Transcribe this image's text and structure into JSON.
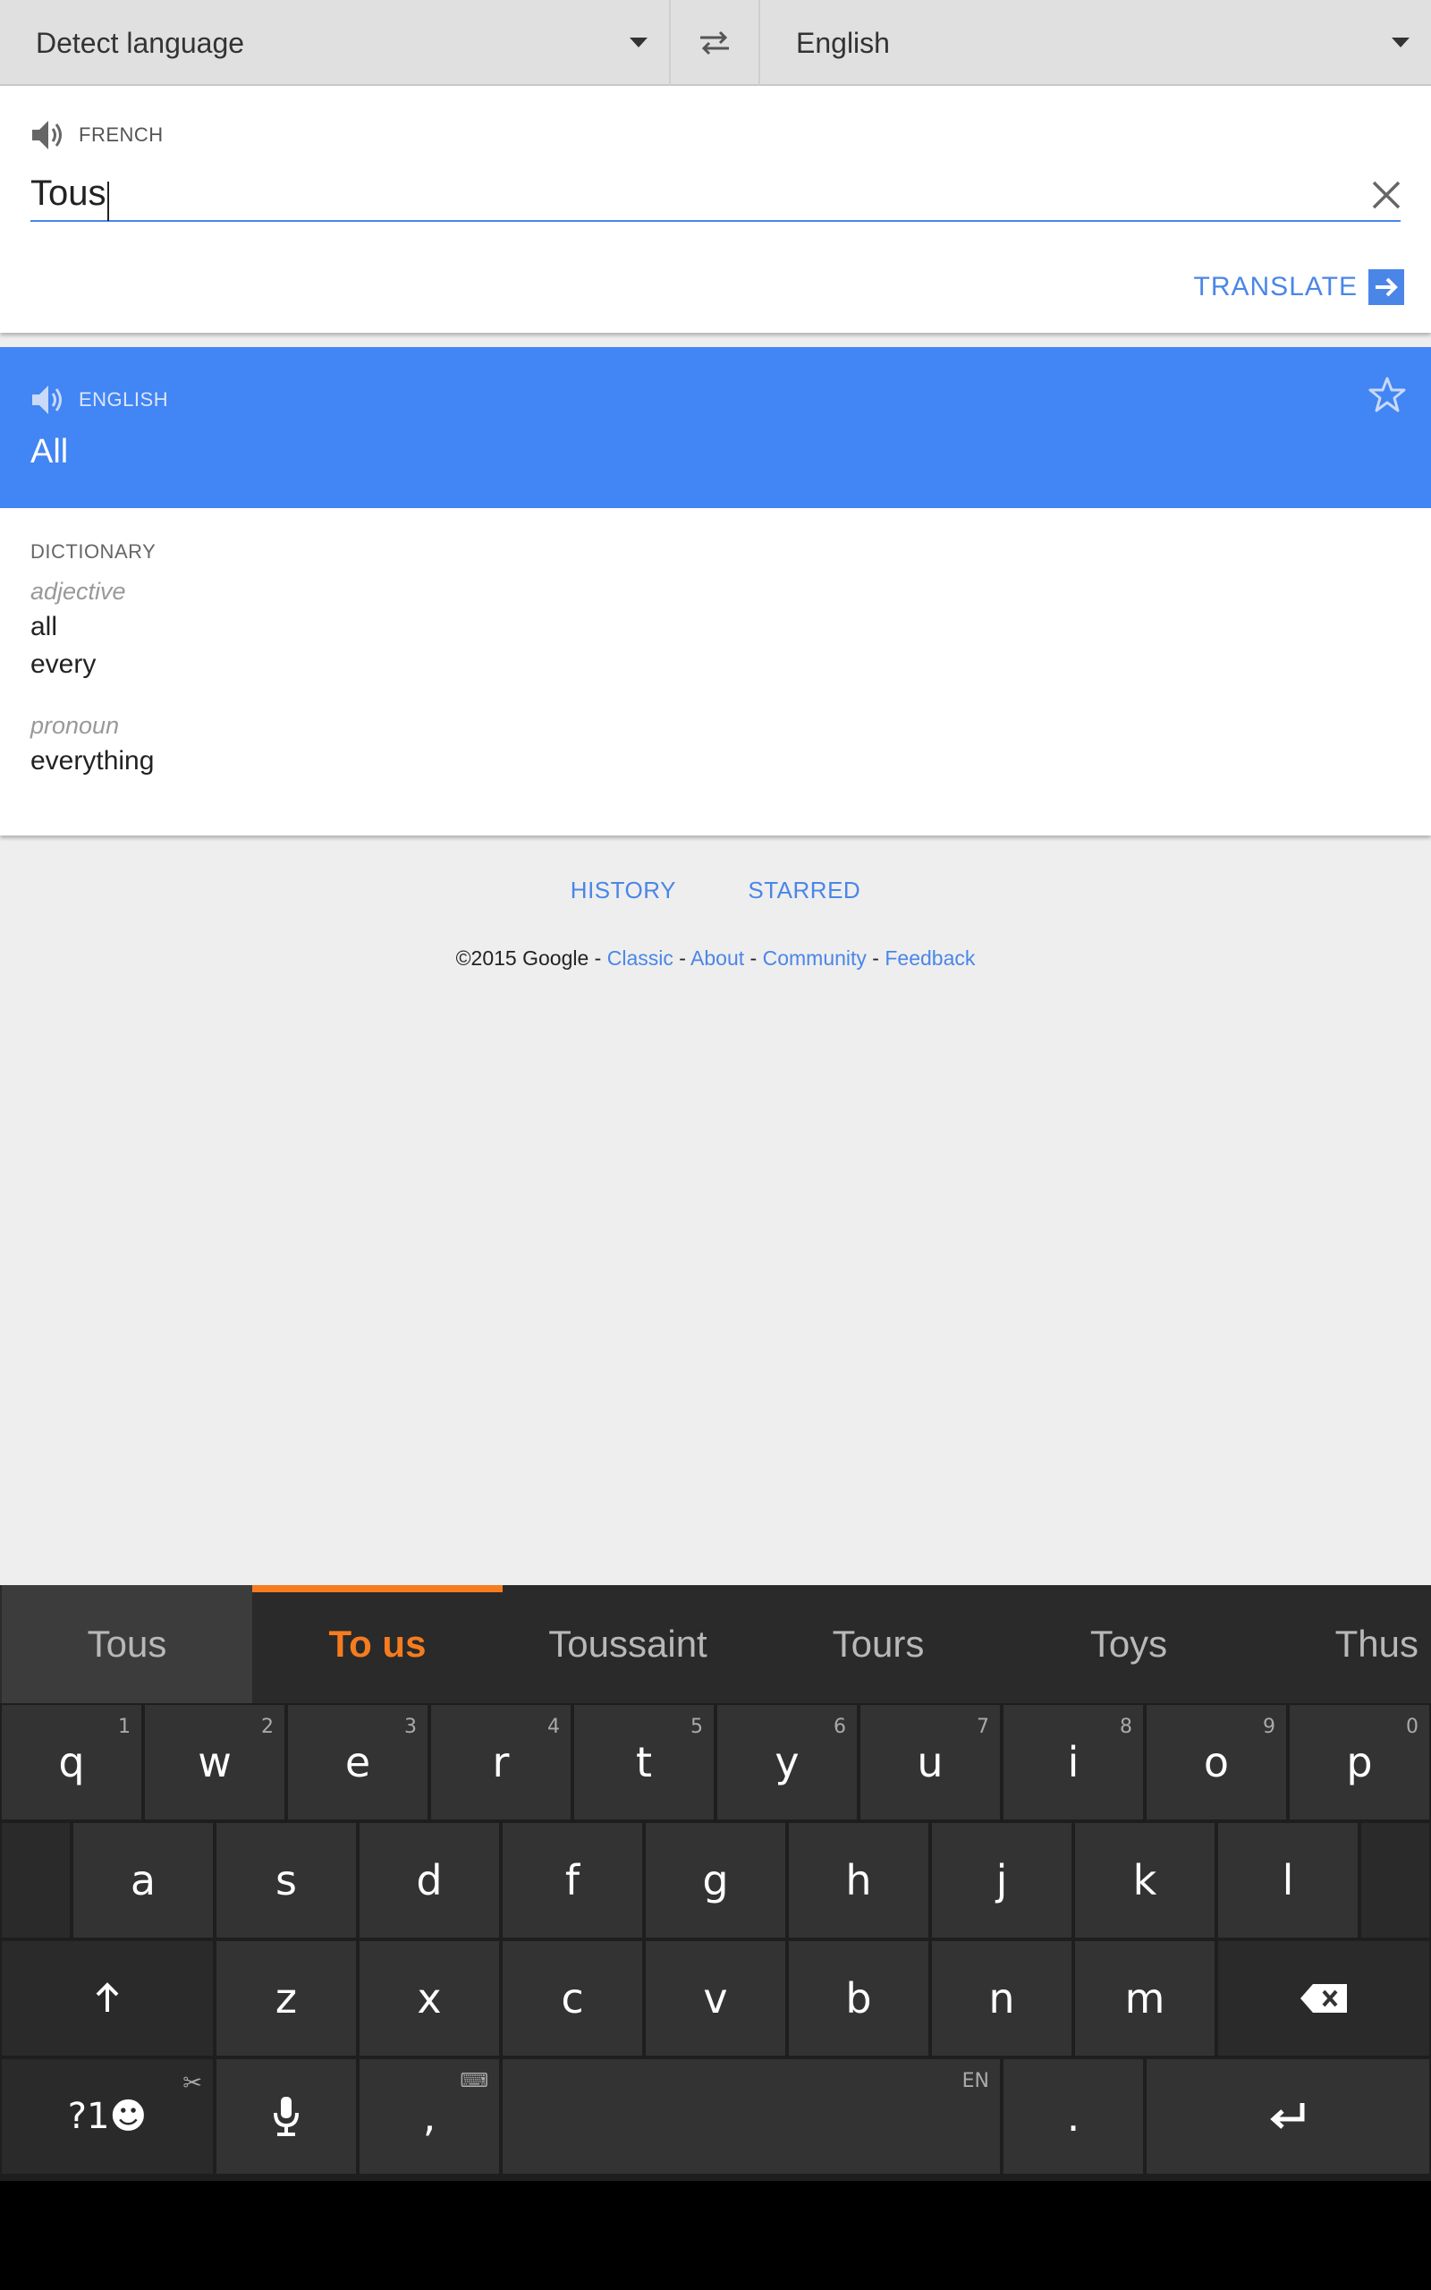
{
  "header": {
    "source_language": "Detect language",
    "target_language": "English"
  },
  "input": {
    "detected_label": "FRENCH",
    "text": "Tous",
    "translate_label": "TRANSLATE"
  },
  "result": {
    "language_label": "ENGLISH",
    "text": "All"
  },
  "dictionary": {
    "title": "DICTIONARY",
    "entries": [
      {
        "pos": "adjective",
        "words": [
          "all",
          "every"
        ]
      },
      {
        "pos": "pronoun",
        "words": [
          "everything"
        ]
      }
    ]
  },
  "tabs": {
    "history": "HISTORY",
    "starred": "STARRED"
  },
  "footer": {
    "copyright": "©2015 Google",
    "sep": " - ",
    "links": [
      "Classic",
      "About",
      "Community",
      "Feedback"
    ]
  },
  "keyboard": {
    "suggestions": [
      "Tous",
      "To us",
      "Toussaint",
      "Tours",
      "Toys",
      "Thus"
    ],
    "row1": [
      {
        "key": "q",
        "hint": "1"
      },
      {
        "key": "w",
        "hint": "2"
      },
      {
        "key": "e",
        "hint": "3"
      },
      {
        "key": "r",
        "hint": "4"
      },
      {
        "key": "t",
        "hint": "5"
      },
      {
        "key": "y",
        "hint": "6"
      },
      {
        "key": "u",
        "hint": "7"
      },
      {
        "key": "i",
        "hint": "8"
      },
      {
        "key": "o",
        "hint": "9"
      },
      {
        "key": "p",
        "hint": "0"
      }
    ],
    "row2": [
      "a",
      "s",
      "d",
      "f",
      "g",
      "h",
      "j",
      "k",
      "l"
    ],
    "row3": [
      "z",
      "x",
      "c",
      "v",
      "b",
      "n",
      "m"
    ],
    "symbols_key": "?1☻",
    "comma_key": ",",
    "space_hint": "EN",
    "period_key": "."
  },
  "colors": {
    "accent": "#4285f4",
    "link": "#4a86e8",
    "suggestion_active": "#f57c20"
  }
}
